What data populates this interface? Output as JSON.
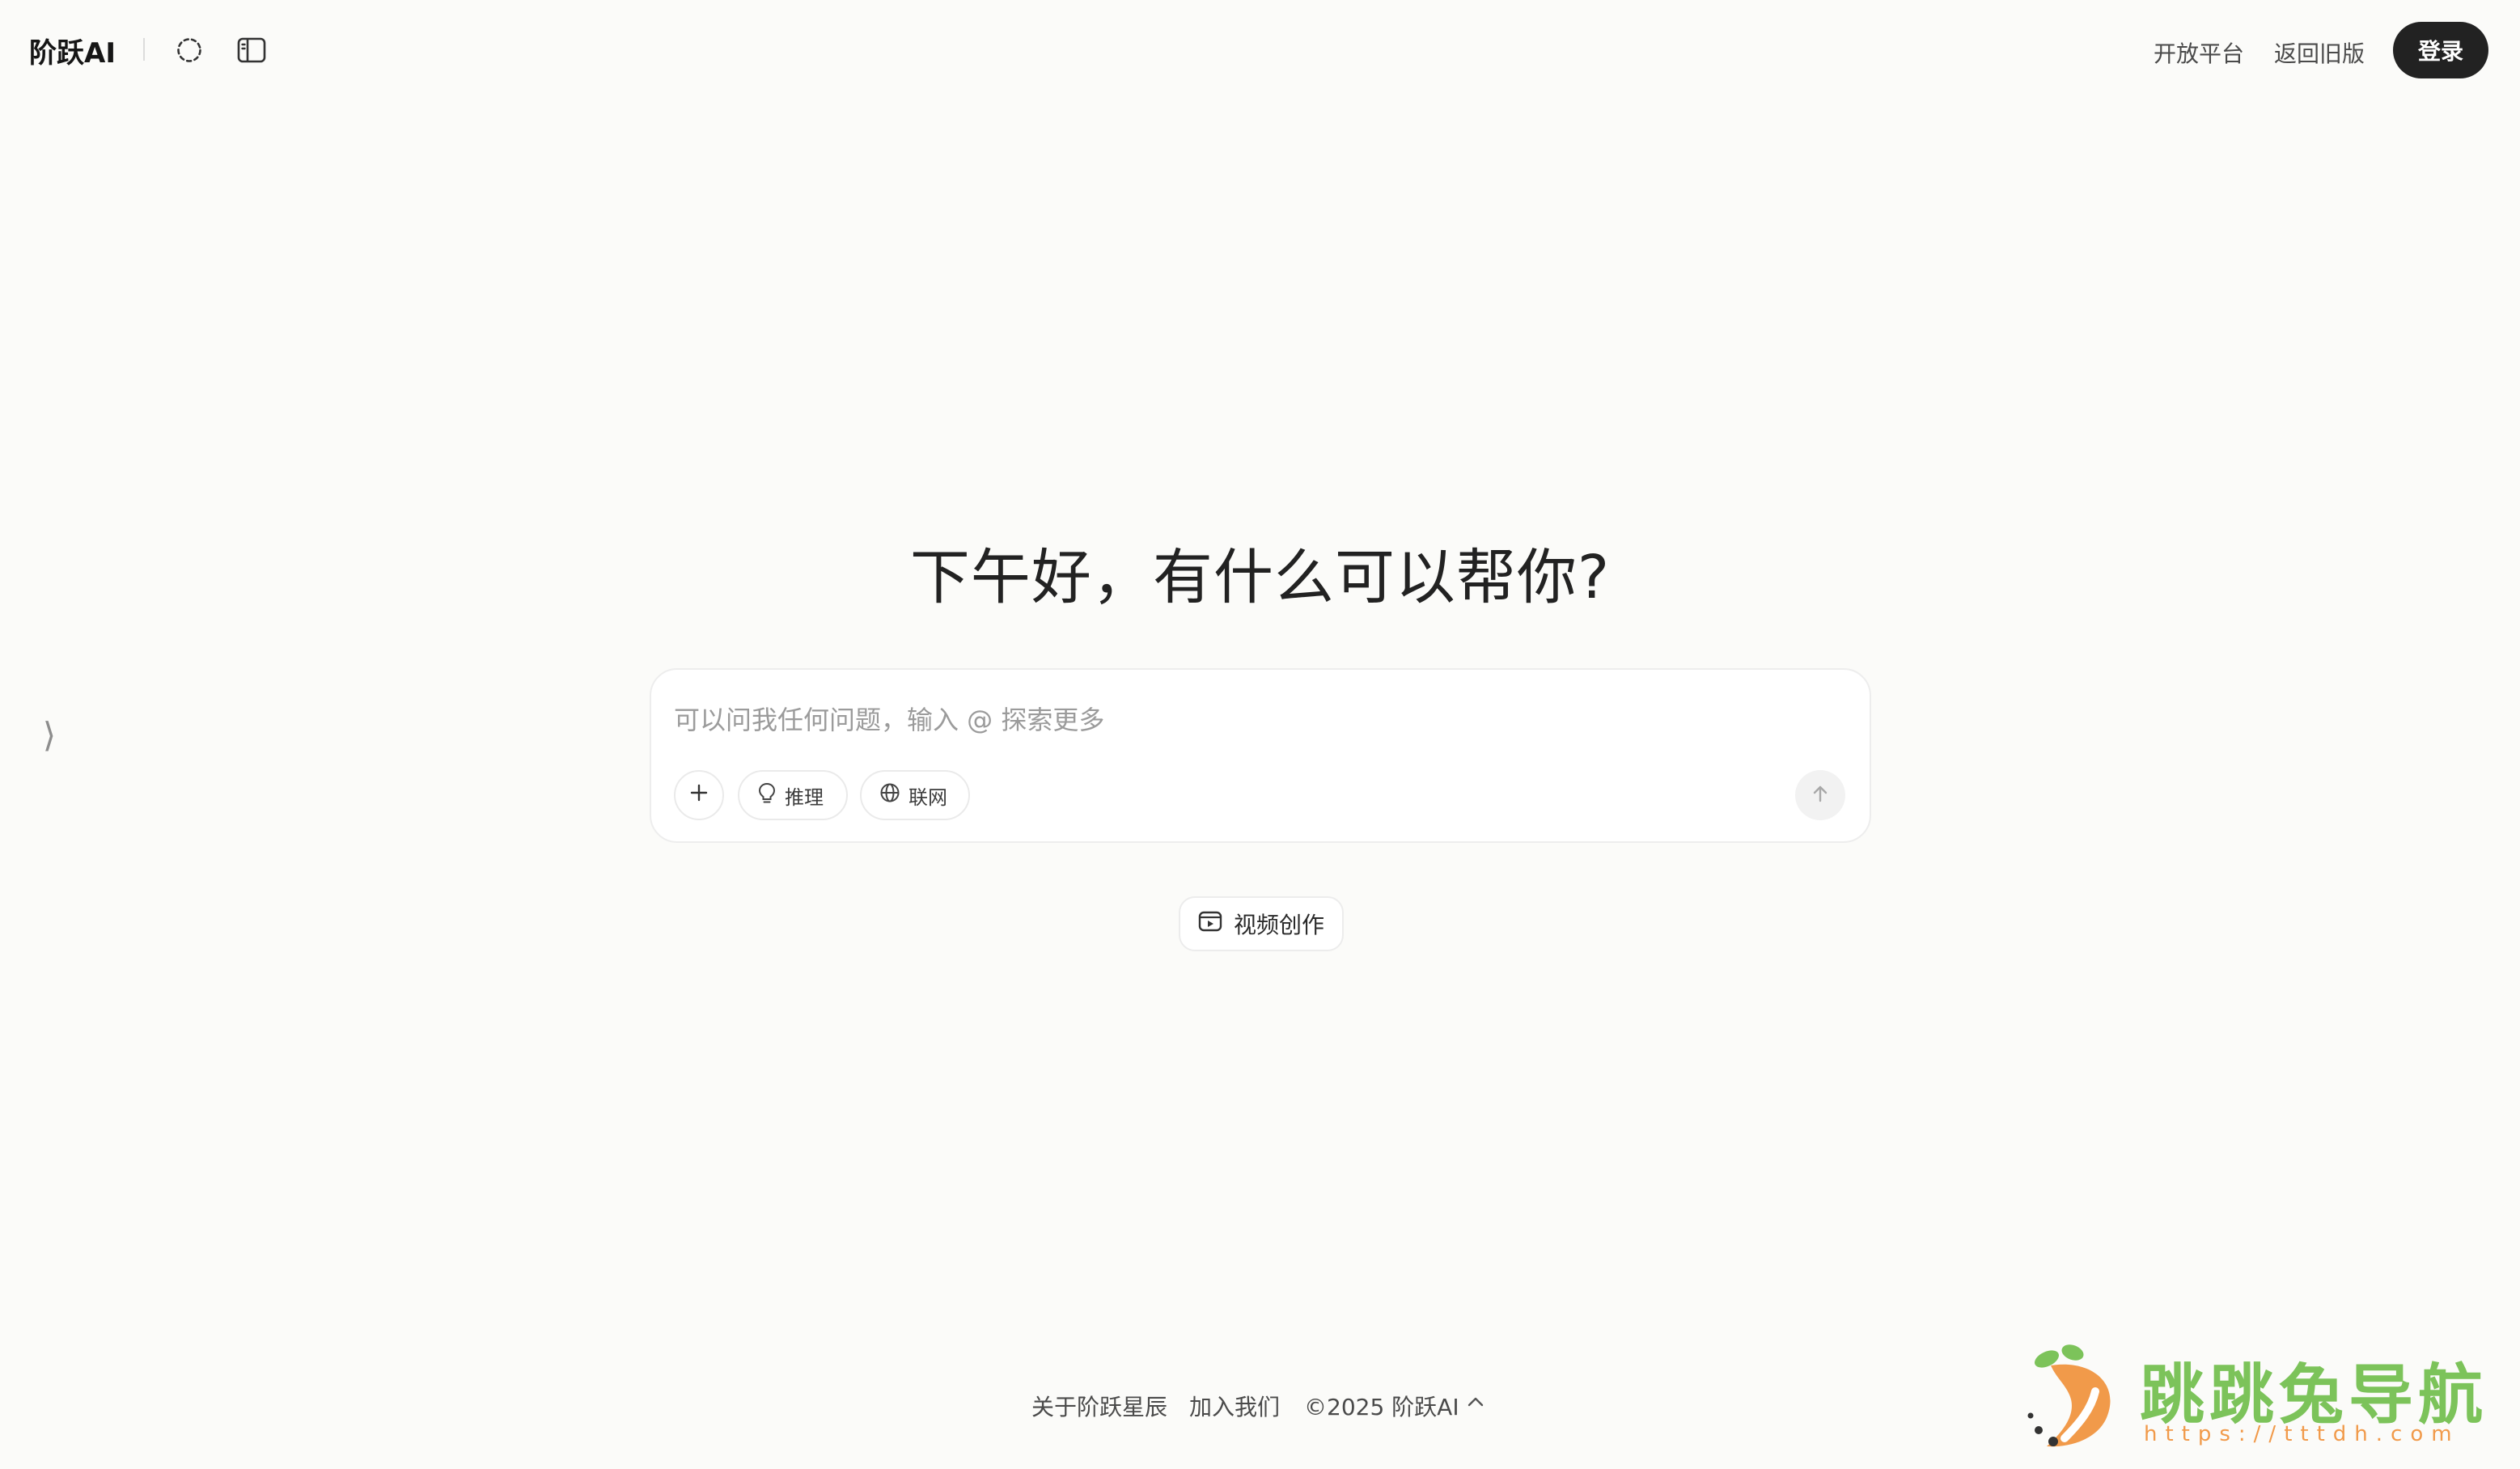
{
  "header": {
    "brand": "阶跃AI",
    "icons": [
      "loading-spinner-icon",
      "sidebar-panel-icon"
    ],
    "nav": {
      "open_platform": "开放平台",
      "old_version": "返回旧版",
      "login": "登录"
    }
  },
  "sidebar": {
    "toggle_glyph": "⟩"
  },
  "main": {
    "greeting": "下午好，有什么可以帮你?",
    "composer": {
      "placeholder": "可以问我任何问题，输入 @ 探索更多",
      "value": "",
      "buttons": {
        "reasoning": "推理",
        "web": "联网"
      },
      "icons": [
        "plus-icon",
        "lightbulb-icon",
        "globe-icon",
        "arrow-up-icon"
      ]
    },
    "video_chip": {
      "label": "视频创作",
      "icon": "video-icon"
    }
  },
  "footer": {
    "about": "关于阶跃星辰",
    "join": "加入我们",
    "copyright": "©2025 阶跃AI",
    "caret_icon": "chevron-up-icon"
  },
  "watermark": {
    "title": "跳跳兔导航",
    "url": "https://tttdh.com"
  },
  "colors": {
    "background": "#fbfbf9",
    "login_button": "#222222",
    "watermark_green": "#7cc35a",
    "watermark_orange": "#f19a4a"
  }
}
